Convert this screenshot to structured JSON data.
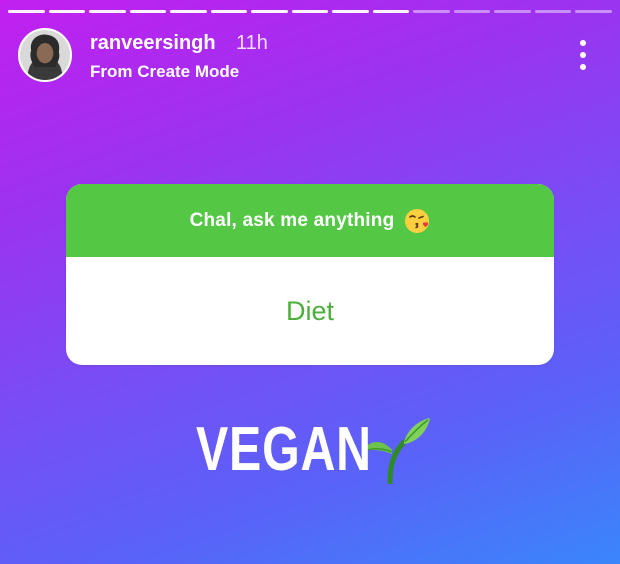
{
  "story": {
    "segments_total": 15,
    "segments_viewed": 10
  },
  "header": {
    "username": "ranveersingh",
    "time": "11h",
    "subtitle": "From Create Mode",
    "more_icon": "more-vertical-icon"
  },
  "question_card": {
    "prompt": "Chal, ask me anything",
    "prompt_emoji": "kissing-face-icon",
    "answer": "Diet",
    "header_color": "#54c744",
    "answer_color": "#4caf3c"
  },
  "caption": {
    "text": "VEGAN",
    "emoji": "seedling-icon"
  }
}
